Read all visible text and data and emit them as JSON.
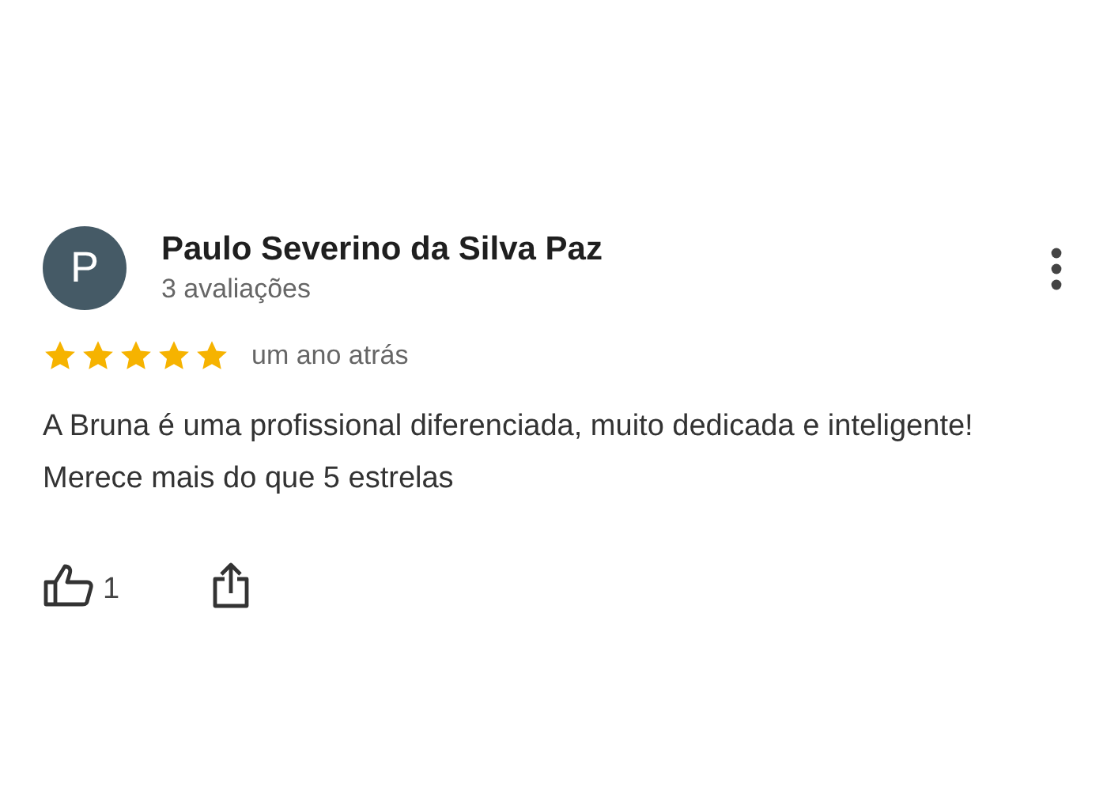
{
  "review": {
    "avatar_letter": "P",
    "author": "Paulo Severino da Silva Paz",
    "author_meta": "3 avaliações",
    "stars": 5,
    "time": "um ano atrás",
    "text": "A Bruna é uma profissional diferenciada, muito dedicada e inteligente! Merece mais do que 5 estrelas",
    "likes": "1"
  }
}
